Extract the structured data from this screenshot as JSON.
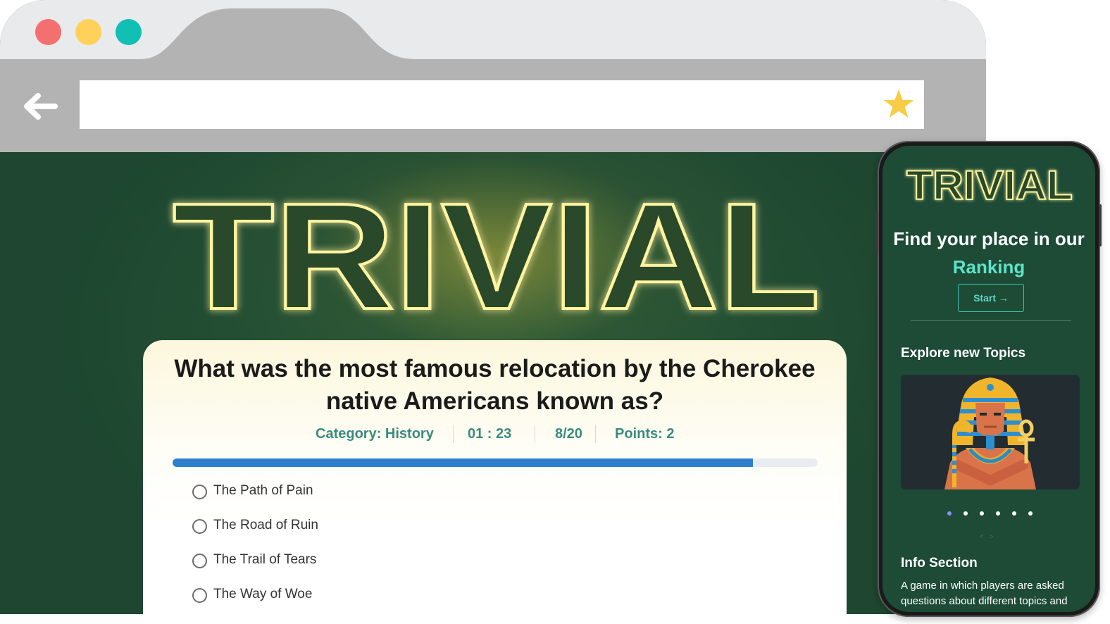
{
  "browser": {
    "window_controls": [
      "close",
      "minimize",
      "maximize"
    ],
    "url": "",
    "icons": {
      "back": "arrow-left-icon",
      "bookmark": "star-icon"
    },
    "colors": {
      "close": "#f46f6f",
      "minimize": "#fdd15a",
      "maximize": "#12bfb5",
      "star": "#f8cc45"
    }
  },
  "page": {
    "logo": "TRIVIAL",
    "question": "What was the most famous relocation by the Cherokee native Americans known as?",
    "meta": {
      "category": "Category: History",
      "timer": "01 : 23",
      "progress": "8/20",
      "points": "Points: 2"
    },
    "progress_fraction": 0.9,
    "options": [
      "The Path of Pain",
      "The Road of Ruin",
      "The Trail of Tears",
      "The Way of Woe"
    ],
    "colors": {
      "background": "#1e4630",
      "accent": "#3a8b7c",
      "progress": "#2f7fcf"
    }
  },
  "mobile": {
    "logo": "TRIVIAL",
    "headline_part1": "Find your place in our",
    "headline_highlight": "Ranking",
    "start_label": "Start →",
    "explore_title": "Explore new Topics",
    "carousel_dot_count": 6,
    "carousel_active_index": 0,
    "info_title": "Info Section",
    "info_text": "A game in which players are asked questions about different topics and",
    "colors": {
      "highlight": "#5de3c8"
    }
  }
}
